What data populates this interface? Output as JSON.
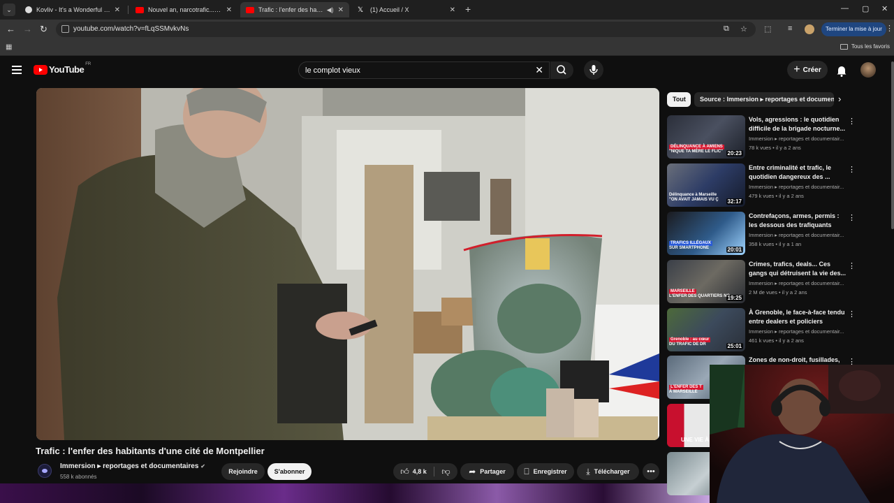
{
  "browser": {
    "tabs": [
      {
        "title": "Kovliv - It's a Wonderful Knife (",
        "active": false
      },
      {
        "title": "Nouvel an, narcotrafic...L'interv",
        "active": false
      },
      {
        "title": "Trafic : l'enfer des habitants",
        "active": true
      },
      {
        "title": "(1) Accueil / X",
        "active": false
      }
    ],
    "url": "youtube.com/watch?v=fLqSSMvkvNs",
    "update_label": "Terminer la mise à jour",
    "all_bookmarks_label": "Tous les favoris"
  },
  "youtube": {
    "logo_text": "YouTube",
    "country_code": "FR",
    "search_query": "le complot vieux",
    "create_label": "Créer"
  },
  "video": {
    "title": "Trafic : l'enfer des habitants d'une cité de Montpellier",
    "channel": "Immersion ▸ reportages et documentaires",
    "subscribers": "558 k abonnés",
    "join_label": "Rejoindre",
    "subscribe_label": "S'abonner",
    "likes": "4,8 k",
    "share_label": "Partager",
    "save_label": "Enregistrer",
    "download_label": "Télécharger"
  },
  "chips": [
    "Tout",
    "Source : Immersion ▸ reportages et documentaires"
  ],
  "recommendations": [
    {
      "title": "Vols, agressions : le quotidien difficile de la brigade nocturne...",
      "channel": "Immersion ▸ reportages et documentair...",
      "meta": "78 k vues • il y a 2 ans",
      "duration": "20:23",
      "overlay_tag": "DÉLINQUANCE À AMIENS",
      "overlay_text": "\"NIQUE TA MÈRE LE FLIC\"",
      "accent": "#d5162f"
    },
    {
      "title": "Entre criminalité et trafic, le quotidien dangereux des ...",
      "channel": "Immersion ▸ reportages et documentair...",
      "meta": "479 k vues • il y a 2 ans",
      "duration": "32:17",
      "overlay_tag": "Délinquance à Marseille",
      "overlay_text": "\"ON AVAIT JAMAIS VU Ç",
      "accent": "#d5162f"
    },
    {
      "title": "Contrefaçons, armes, permis : les dessous des trafiquants",
      "channel": "Immersion ▸ reportages et documentair...",
      "meta": "358 k vues • il y a 1 an",
      "duration": "20:01",
      "overlay_tag": "TRAFICS ILLÉGAUX",
      "overlay_text": "SUR SMARTPHONE",
      "accent": "#2a5ad6"
    },
    {
      "title": "Crimes, trafics, deals... Ces gangs qui détruisent la vie des...",
      "channel": "Immersion ▸ reportages et documentair...",
      "meta": "2 M de vues • il y a 2 ans",
      "duration": "19:25",
      "overlay_tag": "MARSEILLE",
      "overlay_text": "L'ENFER DES QUARTIERS NO",
      "accent": "#d5162f"
    },
    {
      "title": "À Grenoble, le face-à-face tendu entre dealers et policiers",
      "channel": "Immersion ▸ reportages et documentair...",
      "meta": "461 k vues • il y a 2 ans",
      "duration": "25:01",
      "overlay_tag": "Grenoble : au cœur",
      "overlay_text": "DU TRAFIC DE DR",
      "accent": "#d5162f"
    },
    {
      "title": "Zones de non-droit, fusillades,",
      "channel": "",
      "meta": "",
      "duration": "",
      "overlay_tag": "L'ENFER DES T",
      "overlay_text": "À MARSEILLE",
      "accent": "#d5162f"
    },
    {
      "title": "",
      "channel": "",
      "meta": "",
      "duration": "",
      "overlay_tag": "",
      "overlay_text": "UNE VIE À LA FO",
      "accent": "#d5162f"
    }
  ]
}
